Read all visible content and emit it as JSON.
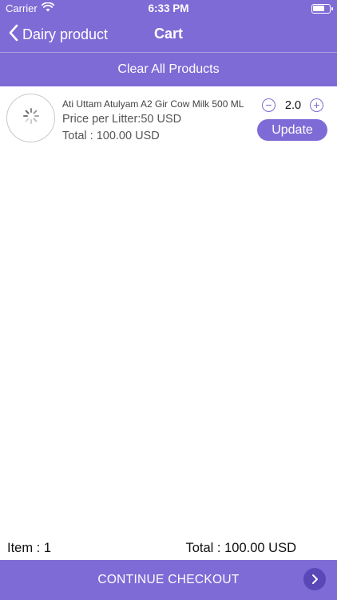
{
  "status_bar": {
    "carrier": "Carrier",
    "time": "6:33 PM"
  },
  "nav": {
    "back_label": "Dairy product",
    "title": "Cart"
  },
  "actions": {
    "clear_all": "Clear All Products"
  },
  "cart": {
    "items": [
      {
        "name": "Ati Uttam Atulyam A2 Gir Cow Milk 500 ML",
        "price": "Price per Litter:50 USD",
        "total": "Total : 100.00 USD",
        "quantity": "2.0",
        "minus_symbol": "−",
        "plus_symbol": "+",
        "update_label": "Update"
      }
    ]
  },
  "summary": {
    "item_count": "Item : 1",
    "grand_total": "Total : 100.00 USD"
  },
  "checkout": {
    "label": "CONTINUE CHECKOUT"
  },
  "colors": {
    "accent": "#7f6bd6",
    "accent_dark": "#5a47b8"
  }
}
